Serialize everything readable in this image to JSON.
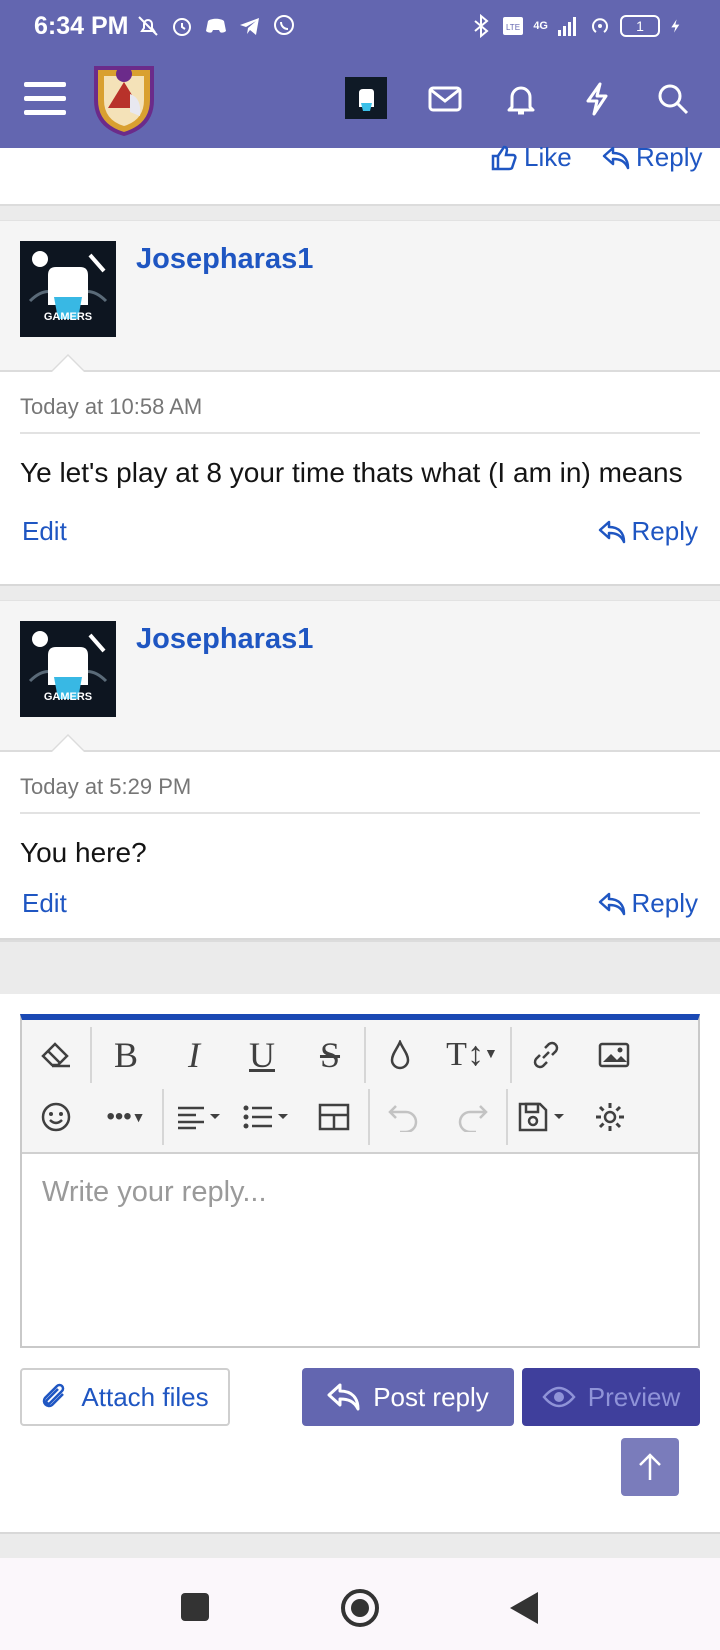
{
  "status_bar": {
    "time": "6:34 PM",
    "network": "4G",
    "battery_level": "1",
    "icons_left": [
      "mute-icon",
      "alarm-icon",
      "discord-icon",
      "telegram-icon",
      "viber-icon"
    ],
    "icons_right": [
      "bluetooth-icon",
      "volte-icon",
      "signal-icon",
      "hotspot-icon",
      "battery-icon",
      "charging-icon"
    ]
  },
  "header": {
    "menu_icon": "hamburger-icon",
    "nav_icons": [
      "avatar",
      "mail-icon",
      "bell-icon",
      "bolt-icon",
      "search-icon"
    ]
  },
  "prev_post_actions": {
    "like": "Like",
    "reply": "Reply"
  },
  "posts": [
    {
      "username": "Josepharas1",
      "avatar_text": "GAMERS",
      "date": "Today at 10:58 AM",
      "text": "Ye let's play at 8 your time thats what (I am in) means",
      "edit": "Edit",
      "reply": "Reply"
    },
    {
      "username": "Josepharas1",
      "avatar_text": "GAMERS",
      "date": "Today at 5:29 PM",
      "text": "You here?",
      "edit": "Edit",
      "reply": "Reply"
    }
  ],
  "editor": {
    "placeholder": "Write your reply...",
    "toolbar_row1": [
      "eraser-icon",
      "bold-icon",
      "italic-icon",
      "underline-icon",
      "strikethrough-icon",
      "text-color-icon",
      "font-size-icon",
      "link-icon",
      "image-icon"
    ],
    "toolbar_row2": [
      "smiley-icon",
      "more-icon",
      "align-icon",
      "list-icon",
      "table-icon",
      "undo-icon",
      "redo-icon",
      "drafts-icon",
      "settings-icon"
    ],
    "accent_color": "#1a49b4"
  },
  "buttons": {
    "attach": "Attach files",
    "post_reply": "Post reply",
    "preview": "Preview"
  },
  "colors": {
    "brand": "#6366b0",
    "link": "#1f56c2"
  },
  "nav_bar": [
    "recents-button",
    "home-button",
    "back-button"
  ]
}
